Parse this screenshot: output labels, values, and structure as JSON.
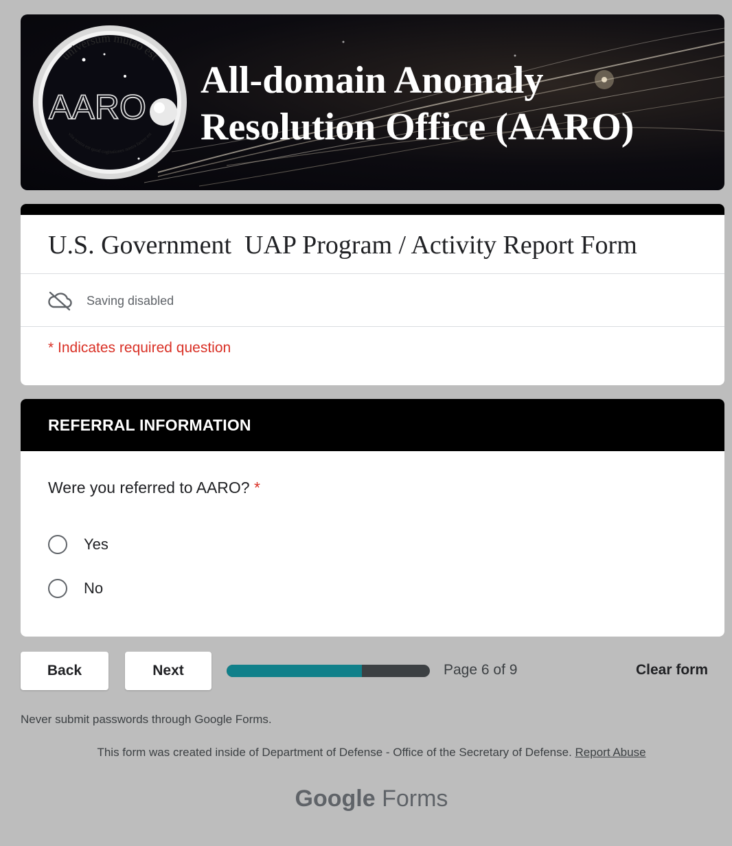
{
  "banner": {
    "title_line1": "All-domain Anomaly",
    "title_line2": "Resolution Office (AARO)",
    "seal_text": "AARO",
    "seal_motto_top": "universum mutao est",
    "seal_motto_bottom": "vita nostra est quod cogitationes nostra facere est"
  },
  "form": {
    "title": "U.S. Government  UAP Program / Activity Report Form",
    "saving_status": "Saving disabled",
    "saving_icon": "cloud-off-icon",
    "required_note": "* Indicates required question"
  },
  "section": {
    "header": "REFERRAL INFORMATION",
    "question": "Were you referred to AARO?",
    "required_mark": "*",
    "options": [
      {
        "label": "Yes",
        "selected": false
      },
      {
        "label": "No",
        "selected": false
      }
    ]
  },
  "nav": {
    "back_label": "Back",
    "next_label": "Next",
    "progress_fraction": 0.6667,
    "page_indicator": "Page 6 of 9",
    "clear_label": "Clear form"
  },
  "footer": {
    "password_note": "Never submit passwords through Google Forms.",
    "created_text": "This form was created inside of Department of Defense - Office of the Secretary of Defense. ",
    "report_abuse": "Report Abuse",
    "brand_google": "Google",
    "brand_forms": " Forms"
  },
  "colors": {
    "page_bg": "#bdbdbd",
    "header_bg": "#000000",
    "required": "#d93025",
    "progress_fill": "#10808a",
    "progress_track": "#3c4043"
  }
}
